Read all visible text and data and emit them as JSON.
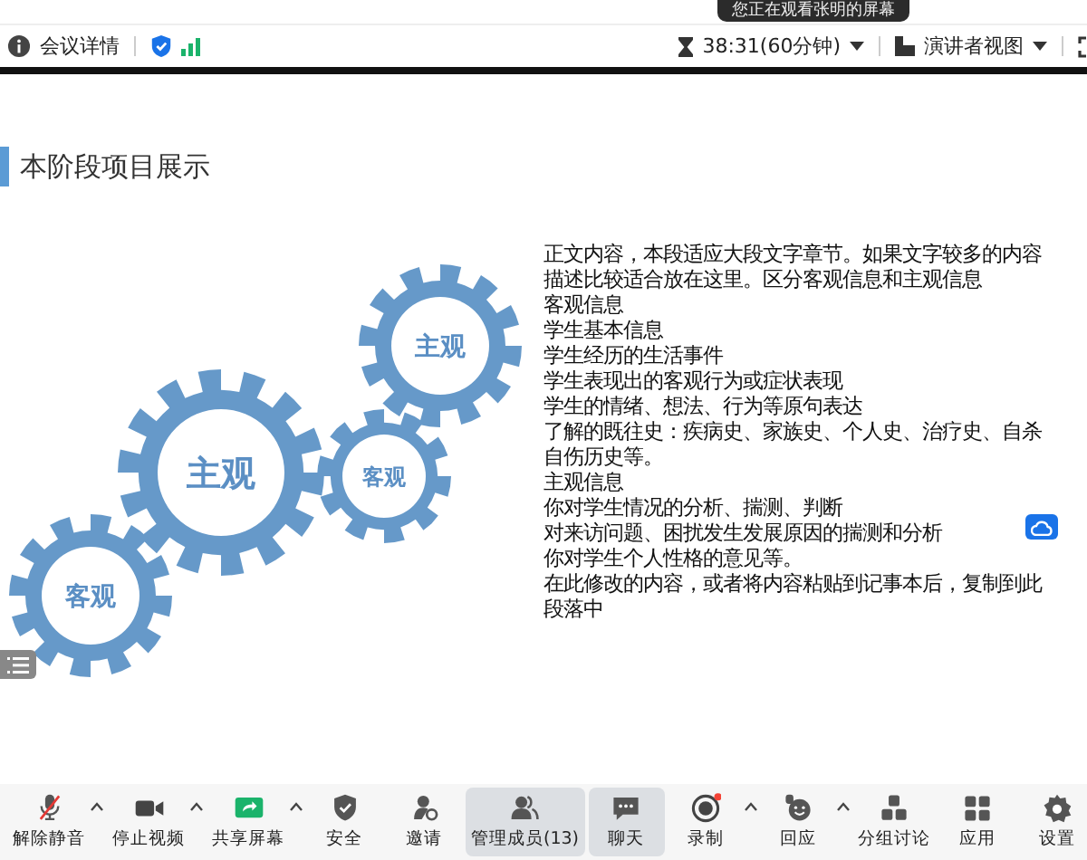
{
  "banner": {
    "text": "您正在观看张明的屏幕"
  },
  "header": {
    "meeting_info": "会议详情",
    "timer": "38:31(60分钟)",
    "view": "演讲者视图"
  },
  "slide": {
    "title": "本阶段项目展示",
    "gears": [
      {
        "label": "主观"
      },
      {
        "label": "主观"
      },
      {
        "label": "客观"
      },
      {
        "label": "客观"
      }
    ],
    "body_lines": [
      "正文内容，本段适应大段文字章节。如果文字较多的内容",
      "描述比较适合放在这里。区分客观信息和主观信息",
      "客观信息",
      "学生基本信息",
      "学生经历的生活事件",
      "学生表现出的客观行为或症状表现",
      "学生的情绪、想法、行为等原句表达",
      "了解的既往史：疾病史、家族史、个人史、治疗史、自杀",
      "自伤历史等。",
      "主观信息",
      "你对学生情况的分析、揣测、判断",
      "对来访问题、困扰发生发展原因的揣测和分析",
      "你对学生个人性格的意见等。",
      "在此修改的内容，或者将内容粘贴到记事本后，复制到此",
      "段落中"
    ]
  },
  "toolbar": [
    {
      "kind": "mic",
      "label": "解除静音",
      "caret": true,
      "active": false
    },
    {
      "kind": "video",
      "label": "停止视频",
      "caret": true,
      "active": false
    },
    {
      "kind": "share",
      "label": "共享屏幕",
      "caret": true,
      "active": false
    },
    {
      "kind": "shield",
      "label": "安全",
      "caret": false,
      "active": false
    },
    {
      "kind": "invite",
      "label": "邀请",
      "caret": false,
      "active": false
    },
    {
      "kind": "people",
      "label": "管理成员(13)",
      "caret": false,
      "active": true
    },
    {
      "kind": "chat",
      "label": "聊天",
      "caret": false,
      "active": true
    },
    {
      "kind": "record",
      "label": "录制",
      "caret": true,
      "active": false
    },
    {
      "kind": "react",
      "label": "回应",
      "caret": true,
      "active": false
    },
    {
      "kind": "breakout",
      "label": "分组讨论",
      "caret": false,
      "active": false
    },
    {
      "kind": "apps",
      "label": "应用",
      "caret": false,
      "active": false
    },
    {
      "kind": "settings",
      "label": "设置",
      "caret": false,
      "active": false
    }
  ]
}
